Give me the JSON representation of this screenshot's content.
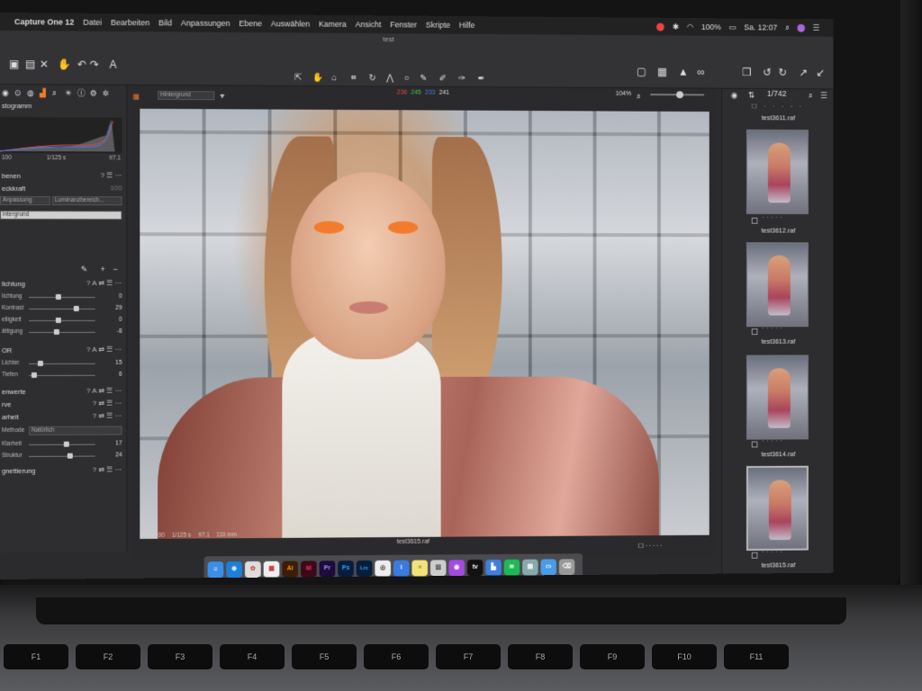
{
  "menubar": {
    "app": "Capture One 12",
    "items": [
      "Datei",
      "Bearbeiten",
      "Bild",
      "Anpassungen",
      "Ebene",
      "Auswählen",
      "Kamera",
      "Ansicht",
      "Fenster",
      "Skripte",
      "Hilfe"
    ],
    "battery": "100%",
    "clock": "Sa. 12:07"
  },
  "window": {
    "title": "test"
  },
  "left": {
    "histogram_title": "stogramm",
    "hist_iso": "100",
    "hist_shutter": "1/125 s",
    "hist_aperture": "f/7.1",
    "layers_title": "benen",
    "opacity_label": "eckkraft",
    "opacity_value": "100",
    "btn_adjust": "Anpassung",
    "btn_luma": "Luminanzbereich...",
    "layer_name": "intergrund",
    "exposure_title": "lichtung",
    "sliders1": [
      {
        "label": "lichtung",
        "value": "0",
        "pos": 0.45
      },
      {
        "label": "Kontrast",
        "value": "29",
        "pos": 0.72
      },
      {
        "label": "elligkeit",
        "value": "0",
        "pos": 0.45
      },
      {
        "label": "ättigung",
        "value": "-8",
        "pos": 0.42
      }
    ],
    "hdr_title": "OR",
    "sliders2": [
      {
        "label": "Lichter",
        "value": "15",
        "pos": 0.18
      },
      {
        "label": "Tiefen",
        "value": "6",
        "pos": 0.08
      }
    ],
    "levels_title": "enwerte",
    "curve_title": "rve",
    "clarity_title": "arheit",
    "method_label": "Methode",
    "method_value": "Natürlich",
    "sliders3": [
      {
        "label": "Klarheit",
        "value": "17",
        "pos": 0.57
      },
      {
        "label": "Struktur",
        "value": "24",
        "pos": 0.62
      }
    ],
    "vignette_title": "gnettierung"
  },
  "viewer": {
    "layer_select": "Hintergrund",
    "rgb": {
      "r": "236",
      "g": "245",
      "b": "233",
      "a": "241"
    },
    "zoom": "104%",
    "meta": {
      "iso": "ISO 100",
      "shutter": "1/125 s",
      "aperture": "f/7.1",
      "focal": "110 mm"
    },
    "filename": "test3615.raf"
  },
  "browser": {
    "count": "1/742",
    "thumbs": [
      "test3611.raf",
      "test3612.raf",
      "test3613.raf",
      "test3614.raf",
      "test3615.raf"
    ]
  },
  "dock": [
    "Finder",
    "Safari",
    "Photos",
    "Calendar",
    "Ai",
    "Id",
    "Pr",
    "Ps",
    "Lrc",
    "Capture One",
    "Info",
    "Notes",
    "Preview",
    "Podcasts",
    "tv",
    "Keynote",
    "Spotify",
    "Stage",
    "Folder",
    "Trash"
  ],
  "keyboard": [
    "F1",
    "F2",
    "F3",
    "F4",
    "F5",
    "F6",
    "F7",
    "F8",
    "F9",
    "F10",
    "F11"
  ],
  "colors": {
    "accent_orange": "#f27b2d",
    "app_bg": "#2b2b2d",
    "rgb_r": "#e34a4a",
    "rgb_g": "#4ec44e",
    "rgb_b": "#4a7de3"
  }
}
